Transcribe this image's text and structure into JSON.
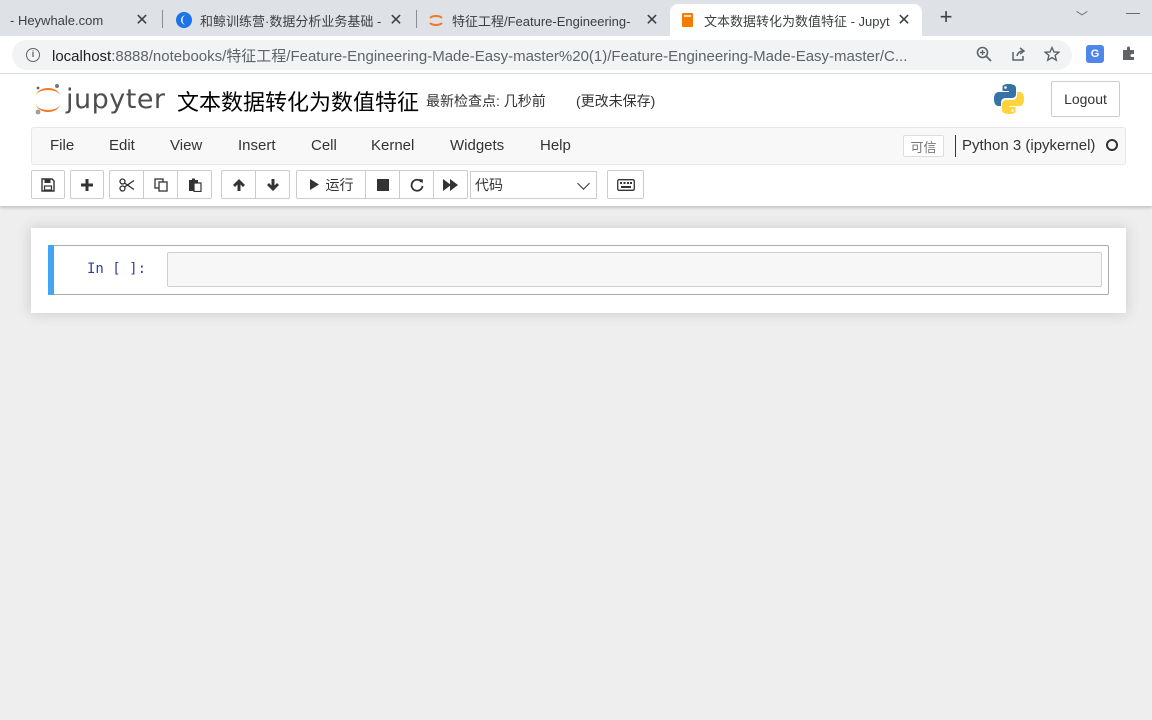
{
  "browser": {
    "tabs": [
      {
        "title": "- Heywhale.com"
      },
      {
        "title": "和鲸训练营·数据分析业务基础 - H"
      },
      {
        "title": "特征工程/Feature-Engineering-"
      },
      {
        "title": "文本数据转化为数值特征 - Jupyter"
      }
    ],
    "address": {
      "host": "localhost",
      "path": ":8888/notebooks/特征工程/Feature-Engineering-Made-Easy-master%20(1)/Feature-Engineering-Made-Easy-master/C..."
    }
  },
  "jupyter": {
    "logo_text": "jupyter",
    "notebook_title": "文本数据转化为数值特征",
    "checkpoint": "最新检查点: 几秒前",
    "save_status": "(更改未保存)",
    "logout_label": "Logout",
    "menu": [
      "File",
      "Edit",
      "View",
      "Insert",
      "Cell",
      "Kernel",
      "Widgets",
      "Help"
    ],
    "trusted_label": "可信",
    "kernel_name": "Python 3 (ipykernel)",
    "toolbar": {
      "run_label": "运行",
      "cell_type": "代码"
    },
    "cell": {
      "prompt": "In [ ]:",
      "content": ""
    }
  },
  "colors": {
    "cell_selected_bar": "#42a5f5",
    "prompt": "#303f9f",
    "jupyter_orange": "#f37726"
  }
}
